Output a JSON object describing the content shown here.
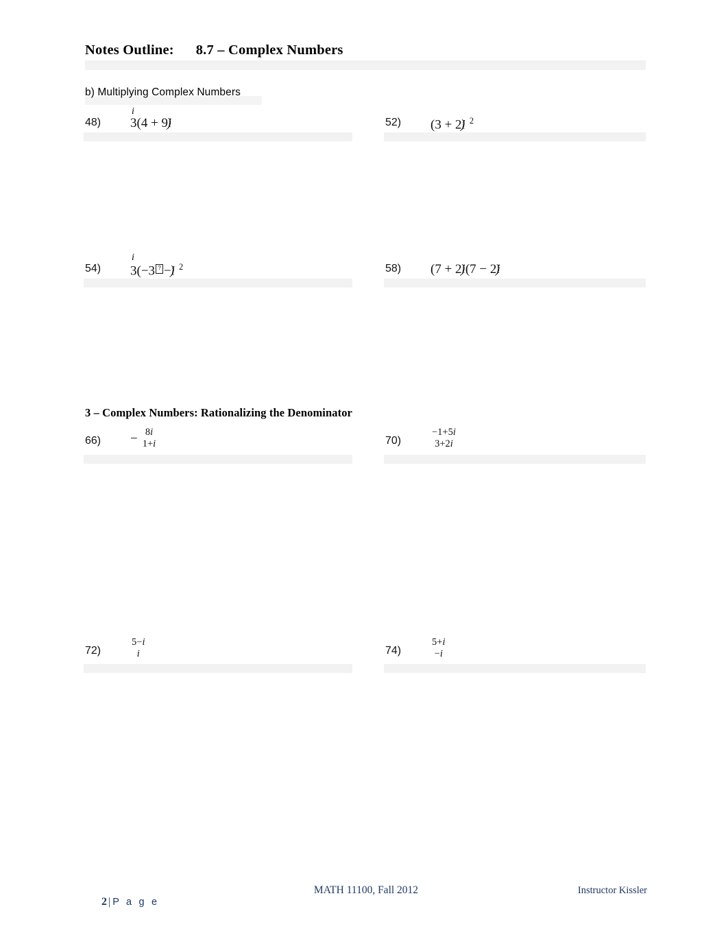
{
  "document": {
    "title_label": "Notes Outline:",
    "title_topic": "8.7 – Complex Numbers",
    "title_full": "Notes Outline:      8.7 – Complex Numbers"
  },
  "sections": {
    "multiplying": {
      "label": "b) Multiplying Complex Numbers"
    },
    "rationalizing": {
      "label": "3 – Complex Numbers: Rationalizing the Denominator"
    }
  },
  "problems": {
    "p48": {
      "number": "48)",
      "float_i": "i",
      "expr_main": "3(4 + 9",
      "expr_close": ")",
      "i_glyph": "i",
      "plain": "3i(4 + 9i)"
    },
    "p52": {
      "number": "52)",
      "expr_main": "(3 + 2",
      "expr_close": ")",
      "i_glyph": "i",
      "exponent": "2",
      "plain": "(3 + 2i)^2"
    },
    "p54": {
      "number": "54)",
      "float_i": "i",
      "expr_lead": "3(−3",
      "tofu": "?",
      "expr_mid": "−",
      "expr_close": ")",
      "i_glyph": "i",
      "exponent": "2",
      "plain": "3i(−3□−i)^2"
    },
    "p58": {
      "number": "58)",
      "expr_a_main": "(7 + 2",
      "expr_a_close": ")",
      "expr_b_main": "(7 − 2",
      "expr_b_close": ")",
      "i_glyph": "i",
      "plain": "(7 + 2i)(7 − 2i)"
    },
    "p66": {
      "number": "66)",
      "lead_minus": "−",
      "numerator_pre": "8",
      "numerator_i": "i",
      "denominator_pre": "1+",
      "denominator_i": "i",
      "plain": "− 8i / (1+i)"
    },
    "p70": {
      "number": "70)",
      "numerator_pre": "−1+5",
      "numerator_i": "i",
      "denominator_pre": "3+2",
      "denominator_i": "i",
      "plain": "(−1+5i) / (3+2i)"
    },
    "p72": {
      "number": "72)",
      "numerator_pre": "5−",
      "numerator_i": "i",
      "denominator_pre": "",
      "denominator_i": "i",
      "plain": "(5−i) / i"
    },
    "p74": {
      "number": "74)",
      "numerator_pre": "5+",
      "numerator_i": "i",
      "denominator_pre": "−",
      "denominator_i": "i",
      "plain": "(5+i) / (−i)"
    }
  },
  "footer": {
    "page_number": "2",
    "separator": "|",
    "page_word": "P a g e",
    "course": "MATH 11100, Fall 2012",
    "instructor": "Instructor Kissler",
    "color": "#1f3864"
  },
  "colors": {
    "text": "#000000",
    "shading_band": "#f2f2f2",
    "footer_navy": "#1f3864",
    "page_background": "#ffffff"
  }
}
